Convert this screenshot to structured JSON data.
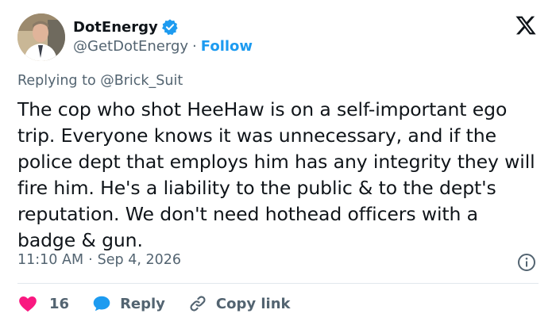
{
  "author": {
    "display_name": "DotEnergy",
    "handle": "@GetDotEnergy",
    "separator": "·",
    "follow_label": "Follow",
    "verified_color": "#1d9bf0"
  },
  "replying": {
    "prefix": "Replying to ",
    "handle": "@Brick_Suit"
  },
  "tweet": {
    "text": "The cop who shot HeeHaw is on a self-important ego trip. Everyone knows it was unnecessary, and if the police dept that employs him has any integrity they will fire him. He's a liability to the public & to the dept's reputation. We don't need hothead officers with a badge & gun.",
    "time": "11:10 AM",
    "separator": "·",
    "date": "Sep 4, 2026"
  },
  "actions": {
    "like_count": "16",
    "reply_label": "Reply",
    "copy_link_label": "Copy link"
  },
  "colors": {
    "like": "#f91880",
    "reply": "#1d9bf0",
    "copy_link": "#1d9bf0",
    "muted": "#536471"
  },
  "icons": {
    "platform_logo": "x-logo-icon",
    "verified": "verified-badge-icon",
    "info": "info-icon",
    "like": "heart-icon",
    "reply": "speech-bubble-icon",
    "copy_link": "link-icon"
  }
}
